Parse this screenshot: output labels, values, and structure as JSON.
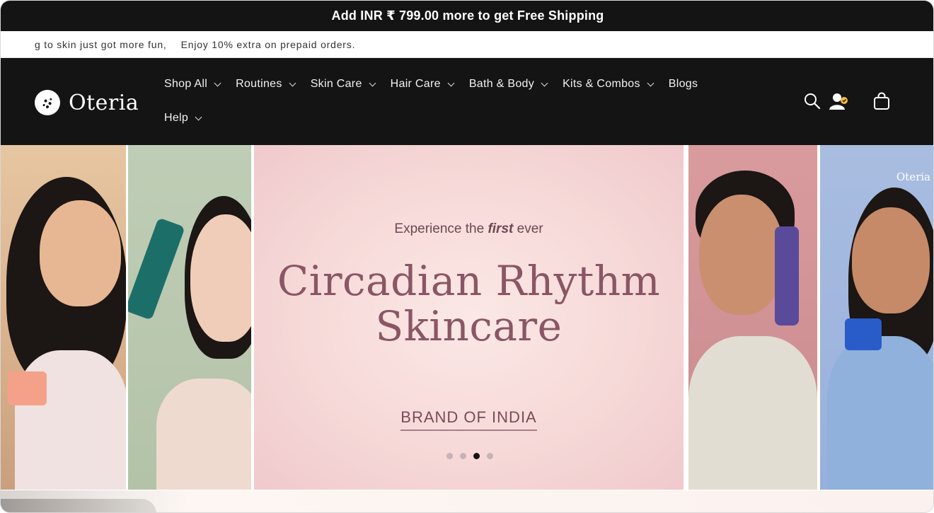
{
  "announcement": {
    "text": "Add INR ₹ 799.00 more to get Free Shipping"
  },
  "marquee": {
    "items": [
      "g to skin just got more fun,",
      "Enjoy 10% extra on prepaid orders."
    ]
  },
  "header": {
    "logo_text": "Oteria",
    "nav": {
      "row1": [
        {
          "label": "Shop All",
          "dropdown": true
        },
        {
          "label": "Routines",
          "dropdown": true
        },
        {
          "label": "Skin Care",
          "dropdown": true
        },
        {
          "label": "Hair Care",
          "dropdown": true
        },
        {
          "label": "Bath & Body",
          "dropdown": true
        },
        {
          "label": "Kits & Combos",
          "dropdown": true
        },
        {
          "label": "Blogs",
          "dropdown": false
        }
      ],
      "row2": [
        {
          "label": "Help",
          "dropdown": true
        }
      ]
    },
    "icons": [
      "search-icon",
      "account-icon",
      "cart-icon"
    ]
  },
  "hero": {
    "kicker_prefix": "Experience the",
    "kicker_emphasis": "first",
    "kicker_suffix": "ever",
    "headline_line1": "Circadian Rhythm",
    "headline_line2": "Skincare",
    "brand_line": "BRAND OF INDIA",
    "watermark": "Oteria",
    "slides_count": 4,
    "active_slide": 3
  },
  "colors": {
    "bar": "#141414",
    "accent_text": "#8a5665",
    "hero_bg": "#f6d9d8"
  }
}
